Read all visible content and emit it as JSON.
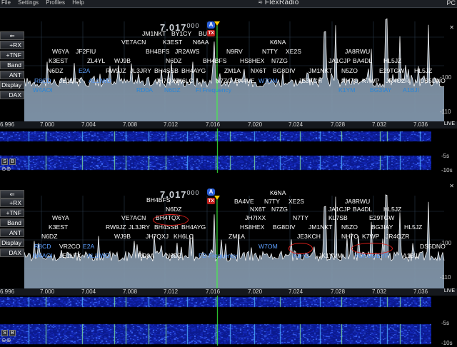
{
  "app": {
    "brand": "FlexRadio",
    "menu": [
      "File",
      "Settings",
      "Profiles",
      "Help"
    ],
    "right_label": "PC"
  },
  "buttons": [
    "+RX",
    "+TNF",
    "Band",
    "ANT",
    "Display",
    "DAX"
  ],
  "freq_ticks": [
    "6.996",
    "7.000",
    "7.004",
    "7.008",
    "7.012",
    "7.016",
    "7.020",
    "7.024",
    "7.028",
    "7.032",
    "7.036"
  ],
  "db_scale_top": [
    "-100",
    "-110"
  ],
  "db_scale_bottom": [
    "-100",
    "-110"
  ],
  "wf_time": [
    "-5s",
    "-10s"
  ],
  "live_label": "LIVE",
  "mag_icons": "⊖⊕",
  "panes": [
    {
      "freq_main": "7.017",
      "freq_sub": "000",
      "ant_label": "A",
      "tx_label": "TX",
      "spots": [
        {
          "t": "JM1NKT",
          "c": "w"
        },
        {
          "t": "BY1CY",
          "c": "w"
        },
        {
          "t": "BU",
          "c": "w"
        },
        {
          "t": "VE7ACN",
          "c": "w"
        },
        {
          "t": "K3EST",
          "c": "w"
        },
        {
          "t": "N6AA",
          "c": "w"
        },
        {
          "t": "K6NA",
          "c": "w"
        },
        {
          "t": "W6YA",
          "c": "w"
        },
        {
          "t": "JF2FIU",
          "c": "w"
        },
        {
          "t": "BH4BFS",
          "c": "w"
        },
        {
          "t": "JR2AWS",
          "c": "w"
        },
        {
          "t": "N9RV",
          "c": "w"
        },
        {
          "t": "N7TY",
          "c": "w"
        },
        {
          "t": "XE2S",
          "c": "w"
        },
        {
          "t": "JA8RWU",
          "c": "w"
        },
        {
          "t": "K3EST",
          "c": "w"
        },
        {
          "t": "ZL4YL",
          "c": "w"
        },
        {
          "t": "WJ9B",
          "c": "w"
        },
        {
          "t": "N6DZ",
          "c": "w"
        },
        {
          "t": "BH4BFS",
          "c": "w"
        },
        {
          "t": "HS8HEX",
          "c": "w"
        },
        {
          "t": "N7ZG",
          "c": "w"
        },
        {
          "t": "JA1CJP",
          "c": "w"
        },
        {
          "t": "BA4DL",
          "c": "w"
        },
        {
          "t": "HL5JZ",
          "c": "w"
        },
        {
          "t": "N6DZ",
          "c": "w"
        },
        {
          "t": "E2A",
          "c": "b"
        },
        {
          "t": "RW9JZ",
          "c": "w"
        },
        {
          "t": "JL3JRY",
          "c": "w"
        },
        {
          "t": "BH4SSB",
          "c": "w"
        },
        {
          "t": "BH4AYG",
          "c": "w"
        },
        {
          "t": "ZM1A",
          "c": "w"
        },
        {
          "t": "NX6T",
          "c": "w"
        },
        {
          "t": "BG8DIV",
          "c": "w"
        },
        {
          "t": "JM1NKT",
          "c": "w"
        },
        {
          "t": "N5ZO",
          "c": "w"
        },
        {
          "t": "E29TGW",
          "c": "w"
        },
        {
          "t": "HL5JZ",
          "c": "w"
        },
        {
          "t": "R8CD",
          "c": "b"
        },
        {
          "t": "JE1LFX",
          "c": "w"
        },
        {
          "t": "AL1IWD",
          "c": "b"
        },
        {
          "t": "JH7QXJ",
          "c": "w"
        },
        {
          "t": "KH6LC",
          "c": "w"
        },
        {
          "t": "N7ZG",
          "c": "w"
        },
        {
          "t": "BA4VE",
          "c": "w"
        },
        {
          "t": "W7OM",
          "c": "b"
        },
        {
          "t": "JE3KCH",
          "c": "w"
        },
        {
          "t": "NH7O",
          "c": "w"
        },
        {
          "t": "K7WP",
          "c": "w"
        },
        {
          "t": "JR4OZR",
          "c": "w"
        },
        {
          "t": "DS5DNO",
          "c": "w"
        },
        {
          "t": "W4AOI",
          "c": "c"
        },
        {
          "t": "RD0A",
          "c": "c"
        },
        {
          "t": "N6DZ",
          "c": "c"
        },
        {
          "t": "Fl Frequency",
          "c": "c"
        },
        {
          "t": "K1YM",
          "c": "c"
        },
        {
          "t": "BG3IAY",
          "c": "c"
        },
        {
          "t": "A1BJI",
          "c": "c"
        }
      ]
    },
    {
      "freq_main": "7.017",
      "freq_sub": "000",
      "ant_label": "A",
      "tx_label": "TX",
      "spots": [
        {
          "t": "BH4BFS",
          "c": "w"
        },
        {
          "t": "K6NA",
          "c": "w"
        },
        {
          "t": "BA4VE",
          "c": "w"
        },
        {
          "t": "N7TY",
          "c": "w"
        },
        {
          "t": "XE2S",
          "c": "w"
        },
        {
          "t": "JA8RWU",
          "c": "w"
        },
        {
          "t": "N6DZ",
          "c": "w"
        },
        {
          "t": "NX6T",
          "c": "w"
        },
        {
          "t": "N7ZG",
          "c": "w"
        },
        {
          "t": "JA1CJP",
          "c": "w"
        },
        {
          "t": "BA4DL",
          "c": "w"
        },
        {
          "t": "HL5JZ",
          "c": "w"
        },
        {
          "t": "W6YA",
          "c": "w"
        },
        {
          "t": "VE7ACN",
          "c": "w"
        },
        {
          "t": "BH4TQX",
          "c": "w"
        },
        {
          "t": "JH7IXX",
          "c": "w"
        },
        {
          "t": "N7TY",
          "c": "w"
        },
        {
          "t": "KL7SB",
          "c": "w"
        },
        {
          "t": "E29TGW",
          "c": "w"
        },
        {
          "t": "K3EST",
          "c": "w"
        },
        {
          "t": "RW9JZ",
          "c": "w"
        },
        {
          "t": "JL3JRY",
          "c": "w"
        },
        {
          "t": "BH4SSB",
          "c": "w"
        },
        {
          "t": "BH4AYG",
          "c": "w"
        },
        {
          "t": "HS8HEX",
          "c": "w"
        },
        {
          "t": "BG8DIV",
          "c": "w"
        },
        {
          "t": "JM1NKT",
          "c": "w"
        },
        {
          "t": "N5ZO",
          "c": "w"
        },
        {
          "t": "BG3IAY",
          "c": "w"
        },
        {
          "t": "HL5JZ",
          "c": "w"
        },
        {
          "t": "N6DZ",
          "c": "w"
        },
        {
          "t": "WJ9B",
          "c": "w"
        },
        {
          "t": "JH7QXJ",
          "c": "w"
        },
        {
          "t": "KH6LC",
          "c": "w"
        },
        {
          "t": "ZM1A",
          "c": "w"
        },
        {
          "t": "JE3KCH",
          "c": "w"
        },
        {
          "t": "NH7O",
          "c": "w"
        },
        {
          "t": "K7WP",
          "c": "w"
        },
        {
          "t": "JR4OZR",
          "c": "w"
        },
        {
          "t": "R8CD",
          "c": "b"
        },
        {
          "t": "VR2CO",
          "c": "w"
        },
        {
          "t": "E2A",
          "c": "b"
        },
        {
          "t": "W7OM",
          "c": "b"
        },
        {
          "t": "DS5DNO",
          "c": "w"
        },
        {
          "t": "W4AOI",
          "c": "b"
        },
        {
          "t": "JE1LFX",
          "c": "w"
        },
        {
          "t": "AL1IWD",
          "c": "b"
        },
        {
          "t": "RD0A",
          "c": "w"
        },
        {
          "t": "N6DZ",
          "c": "w"
        },
        {
          "t": "FD Frequency",
          "c": "b"
        },
        {
          "t": "K3PO",
          "c": "b"
        },
        {
          "t": "JK1YVM",
          "c": "w"
        },
        {
          "t": "YO/HA8BYP",
          "c": "b"
        },
        {
          "t": "A1BJI",
          "c": "w"
        }
      ]
    }
  ],
  "colors": {
    "spectrum_fill": "#9fb2c4",
    "waterfall_bg": "#0a1a8c",
    "highlight": "#e0201c",
    "tx_marker": "#3cff3c",
    "accent": "#2a5fd8"
  }
}
